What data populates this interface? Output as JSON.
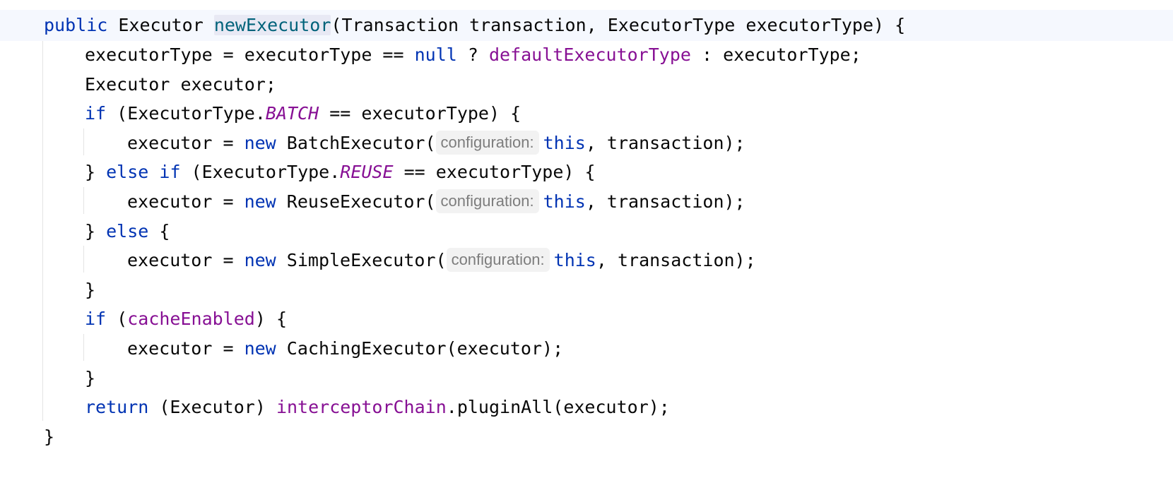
{
  "code": {
    "signature": {
      "kw_public": "public",
      "type": " Executor ",
      "method": "newExecutor",
      "params": "(Transaction transaction, ExecutorType executorType) {"
    },
    "l2": {
      "a": "executorType = executorType == ",
      "kw_null": "null",
      "b": " ? ",
      "field": "defaultExecutorType",
      "c": " : executorType;"
    },
    "l3": {
      "a": "Executor executor;"
    },
    "l4": {
      "kw_if": "if",
      "a": " (ExecutorType.",
      "const": "BATCH",
      "b": " == executorType) {"
    },
    "l5": {
      "a": "executor = ",
      "kw_new": "new",
      "b": " BatchExecutor(",
      "hint": "configuration:",
      "kw_this": "this",
      "c": ", transaction);"
    },
    "l6": {
      "a": "} ",
      "kw_else": "else",
      "b": " ",
      "kw_if": "if",
      "c": " (ExecutorType.",
      "const": "REUSE",
      "d": " == executorType) {"
    },
    "l7": {
      "a": "executor = ",
      "kw_new": "new",
      "b": " ReuseExecutor(",
      "hint": "configuration:",
      "kw_this": "this",
      "c": ", transaction);"
    },
    "l8": {
      "a": "} ",
      "kw_else": "else",
      "b": " {"
    },
    "l9": {
      "a": "executor = ",
      "kw_new": "new",
      "b": " SimpleExecutor(",
      "hint": "configuration:",
      "kw_this": "this",
      "c": ", transaction);"
    },
    "l10": {
      "a": "}"
    },
    "l11": {
      "kw_if": "if",
      "a": " (",
      "field": "cacheEnabled",
      "b": ") {"
    },
    "l12": {
      "a": "executor = ",
      "kw_new": "new",
      "b": " CachingExecutor(executor);"
    },
    "l13": {
      "a": "}"
    },
    "l14": {
      "kw_return": "return",
      "a": " (Executor) ",
      "field": "interceptorChain",
      "b": ".pluginAll(executor);"
    },
    "l15": {
      "a": "}"
    }
  },
  "colors": {
    "keyword": "#0033b3",
    "field": "#871094",
    "method_declaration": "#00627a",
    "text": "#080808",
    "inlay_hint": "#7d7d7d",
    "current_line": "#f5f8fe"
  }
}
